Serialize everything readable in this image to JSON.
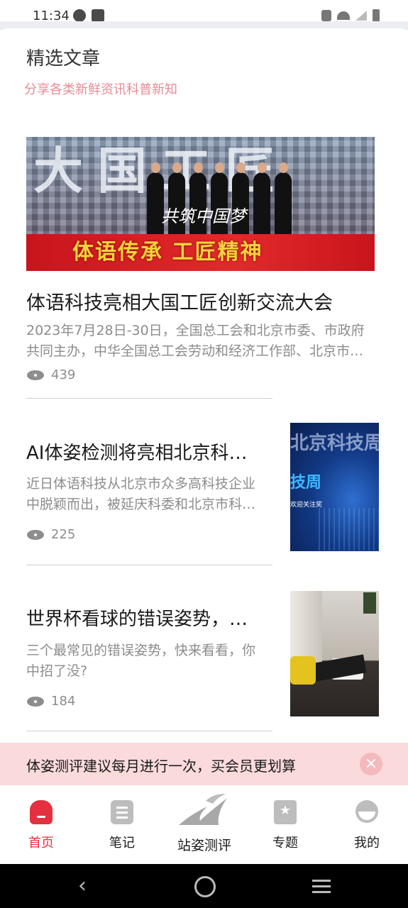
{
  "status_bar": {
    "time": "11:34"
  },
  "section": {
    "title": "精选文章",
    "subtitle": "分享各类新鲜资讯科普新知"
  },
  "hero_image": {
    "slogan": "体语传承 工匠精神",
    "script_text": "共筑中国梦"
  },
  "articles": [
    {
      "title": "体语科技亮相大国工匠创新交流大会",
      "desc_line1": "2023年7月28日-30日，全国总工会和北京市委、市政府",
      "desc_line2": "共同主办，中华全国总工会劳动和经济工作部、北京市…",
      "views": "439"
    },
    {
      "title": "AI体姿检测将亮相北京科…",
      "desc_line1": "近日体语科技从北京市众多高科技企业",
      "desc_line2": "中脱颖而出，被延庆科委和北京市科…",
      "views": "225",
      "thumb_texts": {
        "top": "北京科技周",
        "big": "技周",
        "small": "欢迎关注奖"
      }
    },
    {
      "title": "世界杯看球的错误姿势，…",
      "desc_line1": "三个最常见的错误姿势，快来看看，你",
      "desc_line2": "中招了没?",
      "views": "184"
    }
  ],
  "promo": {
    "text": "体姿测评建议每月进行一次，买会员更划算",
    "close_icon": "×"
  },
  "tabbar": {
    "items": [
      {
        "label": "首页",
        "icon": "home-icon",
        "active": true
      },
      {
        "label": "笔记",
        "icon": "notes-icon",
        "active": false
      },
      {
        "label": "站姿测评",
        "icon": "posture-logo-icon",
        "active": false
      },
      {
        "label": "专题",
        "icon": "topic-icon",
        "active": false
      },
      {
        "label": "我的",
        "icon": "profile-icon",
        "active": false
      }
    ]
  },
  "colors": {
    "accent": "#e5303f",
    "subtitle": "#e88a95",
    "promo_bg": "#fadadb"
  }
}
